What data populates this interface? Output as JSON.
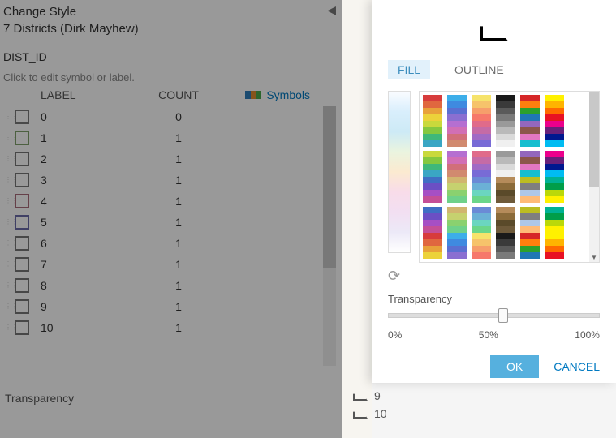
{
  "panel": {
    "title": "Change Style",
    "layer": "7 Districts (Dirk Mayhew)",
    "field": "DIST_ID",
    "hint": "Click to edit symbol or label.",
    "headers": {
      "label": "LABEL",
      "count": "COUNT",
      "symbols": "Symbols"
    },
    "rows": [
      {
        "label": "0",
        "count": "0",
        "border": "#7a7a7a"
      },
      {
        "label": "1",
        "count": "1",
        "border": "#7fa06b"
      },
      {
        "label": "2",
        "count": "1",
        "border": "#777777"
      },
      {
        "label": "3",
        "count": "1",
        "border": "#777777"
      },
      {
        "label": "4",
        "count": "1",
        "border": "#a86b7a"
      },
      {
        "label": "5",
        "count": "1",
        "border": "#6b6ba8"
      },
      {
        "label": "6",
        "count": "1",
        "border": "#777777"
      },
      {
        "label": "7",
        "count": "1",
        "border": "#777777"
      },
      {
        "label": "8",
        "count": "1",
        "border": "#777777"
      },
      {
        "label": "9",
        "count": "1",
        "border": "#777777"
      },
      {
        "label": "10",
        "count": "1",
        "border": "#777777"
      }
    ],
    "transparency_label": "Transparency"
  },
  "legend_extra": [
    {
      "label": "9"
    },
    {
      "label": "10"
    }
  ],
  "popup": {
    "tabs": {
      "fill": "FILL",
      "outline": "OUTLINE",
      "active": "fill"
    },
    "transparency_label": "Transparency",
    "slider": {
      "min_label": "0%",
      "mid_label": "50%",
      "max_label": "100%",
      "value_pct": 52
    },
    "buttons": {
      "ok": "OK",
      "cancel": "CANCEL"
    },
    "ramp_colors": [
      "#fafcff",
      "#d9eefc",
      "#cdeaf6",
      "#eaf4df",
      "#fbead0",
      "#f8dce9",
      "#f2dff2",
      "#ece9f7",
      "#ffffff"
    ],
    "swatch_columns": [
      [
        "#d73c3c",
        "#e0673f",
        "#e8a13a",
        "#ecd23a",
        "#c9d93c",
        "#85c83f",
        "#3fb87a",
        "#3aa6c4",
        "#3f6fc4",
        "#6b4fc4",
        "#a64fc4",
        "#c44f97"
      ],
      [
        "#3daee9",
        "#3f8ae0",
        "#5a6fd1",
        "#8a6fd1",
        "#b56fd1",
        "#d16fb5",
        "#d16f7a",
        "#d18a6f",
        "#d1b56f",
        "#c6d16f",
        "#8ad16f",
        "#6fd18a"
      ],
      [
        "#f6e36b",
        "#f6c36b",
        "#f69e6b",
        "#f6786b",
        "#e06b8a",
        "#c56ba6",
        "#a06bc5",
        "#786bd6",
        "#6b8ad6",
        "#6bb0d6",
        "#6bd6c0",
        "#6bd68a"
      ],
      [
        "#1a1a1a",
        "#3a3a3a",
        "#5a5a5a",
        "#7a7a7a",
        "#9a9a9a",
        "#bababa",
        "#dadada",
        "#f0f0f0",
        "#b58b5a",
        "#8b6b3a",
        "#5a4a2a",
        "#6e5a3a"
      ],
      [
        "#d62728",
        "#ff7f0e",
        "#2ca02c",
        "#1f77b4",
        "#9467bd",
        "#8c564b",
        "#e377c2",
        "#17becf",
        "#bcbd22",
        "#7f7f7f",
        "#aec7e8",
        "#ffbb78"
      ],
      [
        "#fff100",
        "#ffb400",
        "#ff6a00",
        "#e81123",
        "#ec008c",
        "#68217a",
        "#00188f",
        "#00bcf2",
        "#00b294",
        "#009e49",
        "#bad80a",
        "#fff100"
      ]
    ]
  },
  "symbols_ico_colors": [
    "#2e7ebb",
    "#e08a2e",
    "#4aa84a"
  ]
}
